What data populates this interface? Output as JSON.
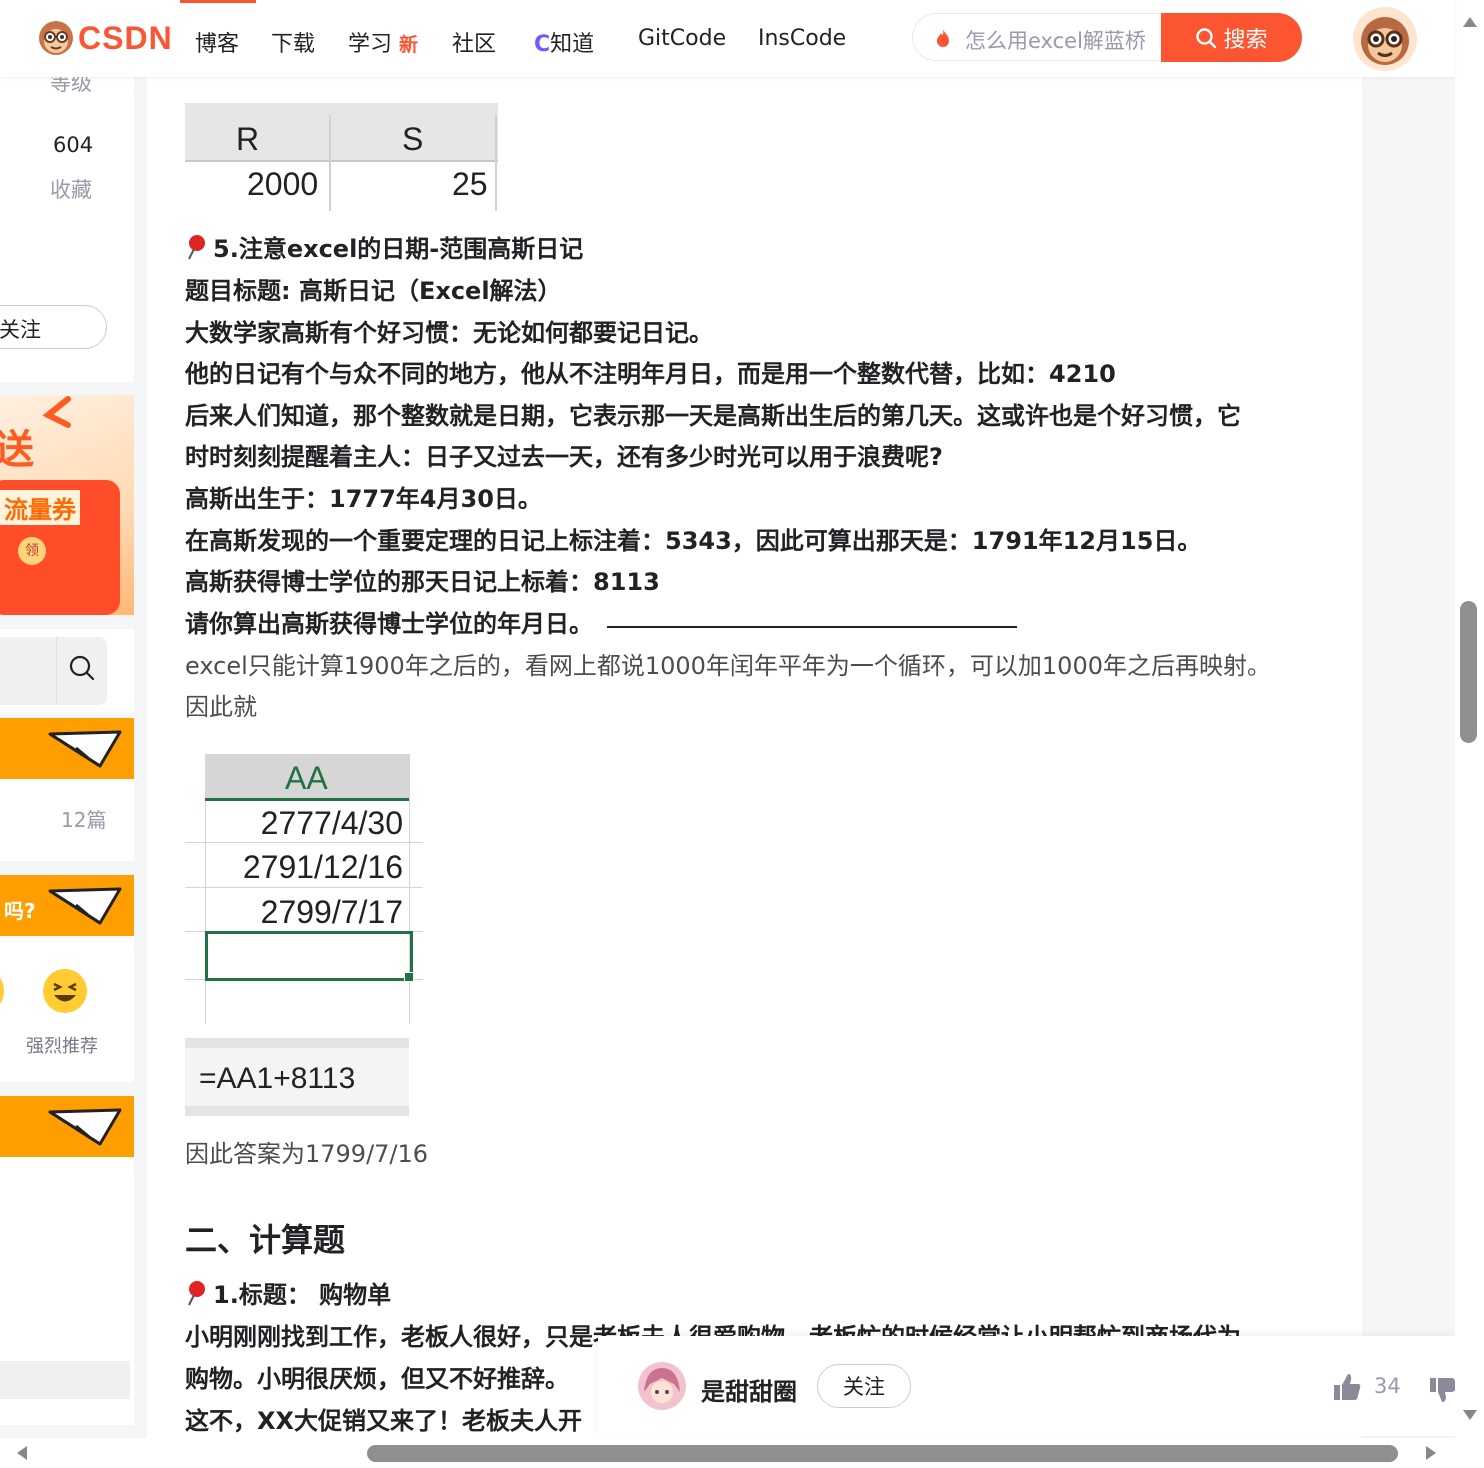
{
  "nav": {
    "logo_text": "CSDN",
    "items": [
      "博客",
      "下载",
      "学习",
      "社区",
      "知道",
      "GitCode",
      "InsCode"
    ],
    "learn_badge": "新",
    "search_placeholder": "怎么用excel解蓝桥",
    "search_button": "搜索",
    "accent_color": "#fc5531"
  },
  "sidebar": {
    "rank_label": "等级",
    "stat_value": "604",
    "stat_label": "收藏",
    "follow_label": "关注",
    "promo_text_1": "送",
    "promo_text_2": "流量券",
    "promo_badge": "领",
    "article_count": "12篇",
    "question_text": "吗?",
    "reaction_label": "强烈推荐"
  },
  "article": {
    "table1": {
      "headers": [
        "R",
        "S"
      ],
      "values": [
        "2000",
        "25"
      ]
    },
    "section5_title": "5.注意excel的日期-范围高斯日记",
    "lines": [
      "题目标题: 高斯日记（Excel解法）",
      "大数学家高斯有个好习惯：无论如何都要记日记。",
      "他的日记有个与众不同的地方，他从不注明年月日，而是用一个整数代替，比如：4210",
      "后来人们知道，那个整数就是日期，它表示那一天是高斯出生后的第几天。这或许也是个好习惯，它",
      "时时刻刻提醒着主人：日子又过去一天，还有多少时光可以用于浪费呢?",
      "高斯出生于：1777年4月30日。",
      "在高斯发现的一个重要定理的日记上标注着：5343，因此可算出那天是：1791年12月15日。",
      "高斯获得博士学位的那天日记上标着：8113",
      "请你算出高斯获得博士学位的年月日。"
    ],
    "note_1": "excel只能计算1900年之后的，看网上都说1000年闰年平年为一个循环，可以加1000年之后再映射。",
    "note_2": "因此就",
    "table2": {
      "header": "AA",
      "rows": [
        "2777/4/30",
        "2791/12/16",
        "2799/7/17"
      ]
    },
    "formula": "=AA1+8113",
    "answer": "因此答案为1799/7/16",
    "section2_heading": "二、计算题",
    "q1_title": "1.标题： 购物单",
    "q1_lines": [
      "小明刚刚找到工作，老板人很好，只是老板夫人很爱购物。老板忙的时候经常让小明帮忙到商场代为",
      "购物。小明很厌烦，但又不好推辞。",
      "这不，XX大促销又来了！老板夫人开"
    ]
  },
  "author": {
    "name": "是甜甜圈",
    "follow": "关注",
    "likes": "34"
  }
}
